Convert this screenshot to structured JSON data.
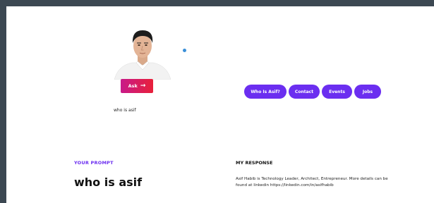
{
  "ask_button": {
    "label": "Ask",
    "arrow": "→"
  },
  "query": {
    "text": "who is asif"
  },
  "nav": {
    "items": [
      {
        "label": "Who Is Asif?"
      },
      {
        "label": "Contact"
      },
      {
        "label": "Events"
      },
      {
        "label": "Jobs"
      }
    ]
  },
  "prompt": {
    "label": "YOUR PROMPT",
    "text": "who is asif"
  },
  "response": {
    "label": "MY RESPONSE",
    "text": "Asif Habib is Technology Leader, Architect, Entrepreneur. More details can be found at linkedin https://linkedin.com/in/asifhabib"
  },
  "colors": {
    "accent": "#6b2ef0",
    "ask_gradient_start": "#c81a8a",
    "ask_gradient_end": "#e8203a",
    "status_dot": "#3a8fd8",
    "frame": "#3c4852"
  },
  "icons": {
    "ask_arrow": "arrow-right-icon"
  }
}
